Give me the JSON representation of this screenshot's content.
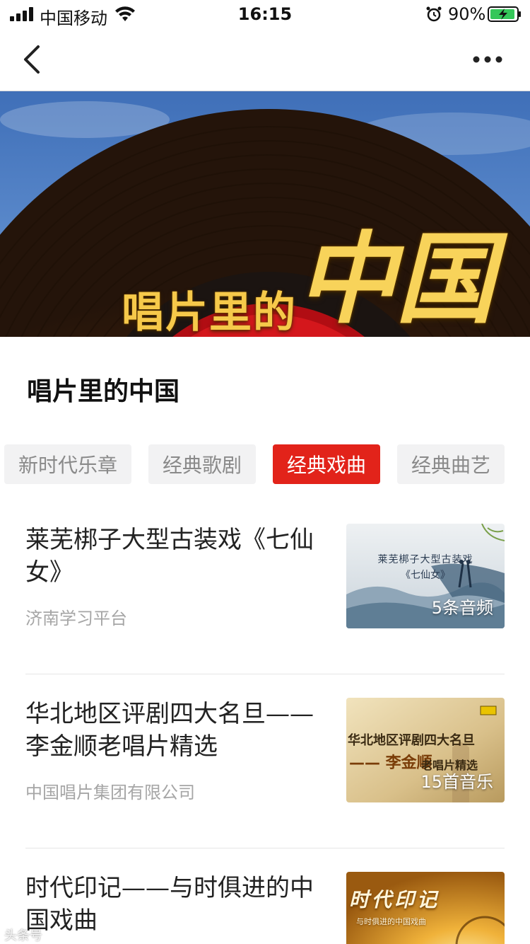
{
  "status_bar": {
    "carrier": "中国移动",
    "time": "16:15",
    "battery_percent": "90%"
  },
  "nav": {
    "back_icon": "chevron-left-icon",
    "more_icon": "more-dots-icon"
  },
  "banner": {
    "title_small": "唱片里的",
    "title_big": "中国"
  },
  "section": {
    "title": "唱片里的中国"
  },
  "tabs": [
    {
      "label": "新时代乐章",
      "active": false
    },
    {
      "label": "经典歌剧",
      "active": false
    },
    {
      "label": "经典戏曲",
      "active": true
    },
    {
      "label": "经典曲艺",
      "active": false
    }
  ],
  "items": [
    {
      "title": "莱芜梆子大型古装戏《七仙女》",
      "source": "济南学习平台",
      "thumb_line1": "莱芜梆子大型古装戏",
      "thumb_line2": "《七仙女》",
      "count": "5条音频"
    },
    {
      "title": "华北地区评剧四大名旦——李金顺老唱片精选",
      "source": "中国唱片集团有限公司",
      "thumb_line1": "华北地区评剧四大名旦",
      "thumb_line2": "—— 李金顺",
      "thumb_line3": "老唱片精选",
      "count": "15首音乐"
    },
    {
      "title": "时代印记——与时俱进的中国戏曲",
      "thumb_line1": "时代印记",
      "thumb_line2": "与时俱进的中国戏曲"
    }
  ],
  "watermark": "头条号"
}
